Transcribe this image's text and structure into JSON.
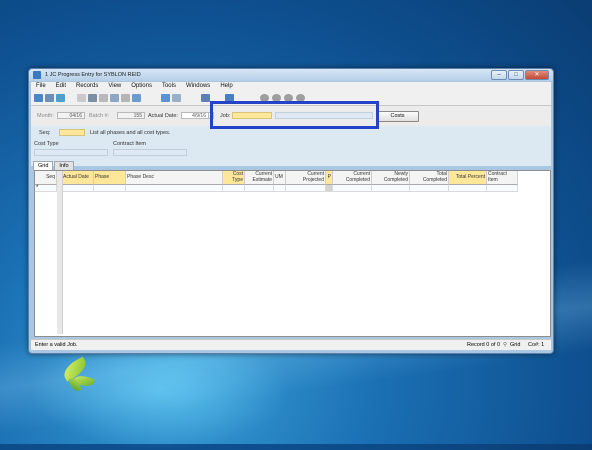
{
  "window": {
    "title": "1 JC Progress Entry for SYBLON REID"
  },
  "menu": [
    "File",
    "Edit",
    "Records",
    "View",
    "Options",
    "Tools",
    "Windows",
    "Help"
  ],
  "form": {
    "month_label": "Month:",
    "month_value": "04/16",
    "batch_label": "Batch #:",
    "batch_value": "155",
    "actual_date_label": "Actual Date:",
    "actual_date_value": "4/9/16",
    "job_label": "Job:",
    "costs_button": "Costs",
    "seq_label": "Seq:",
    "seq_hint": "List all phases and  all cost types.",
    "cost_type_label": "Cost Type",
    "contract_item_label": "Contract Item"
  },
  "tabs": [
    "Grid",
    "Info"
  ],
  "grid": {
    "columns": [
      "Seq",
      "Actual Date",
      "Phase",
      "Phase Desc",
      "Cost Type",
      "Current Estimate",
      "UM",
      "Current Projected",
      "P",
      "Current Completed",
      "Newly Completed",
      "Total Completed",
      "Total Percent",
      "Contract Item"
    ],
    "row_marker": "*"
  },
  "status": {
    "message": "Enter a valid Job.",
    "record": "Record 0 of 0",
    "grid_label": "Grid",
    "co": "Co#: 1"
  },
  "colors": {
    "highlight": "#2443c9",
    "required_field": "#ffe79a"
  }
}
